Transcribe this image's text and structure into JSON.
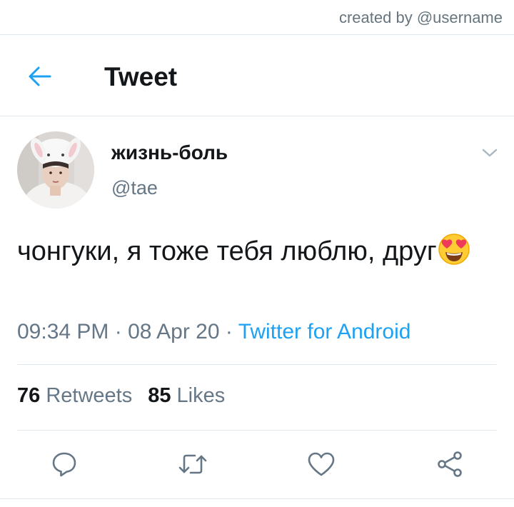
{
  "credit": "created by @username",
  "header": {
    "back_icon": "arrow-left-icon",
    "title": "Tweet"
  },
  "author": {
    "display_name": "жизнь-боль",
    "handle": "@tae",
    "avatar": "avatar-photo"
  },
  "tweet": {
    "text": "чонгуки, я тоже тебя люблю, друг",
    "emoji": "smiling-face-with-heart-eyes-emoji",
    "time": "09:34 PM",
    "date": "08 Apr 20",
    "separator": "·",
    "source": "Twitter for Android"
  },
  "stats": {
    "retweets_count": "76",
    "retweets_label": "Retweets",
    "likes_count": "85",
    "likes_label": "Likes"
  },
  "actions": [
    "reply-icon",
    "retweet-icon",
    "like-icon",
    "share-icon"
  ],
  "colors": {
    "accent": "#1da1f2",
    "secondary_text": "#657786",
    "primary_text": "#14171a",
    "divider": "#e1e8ed"
  }
}
